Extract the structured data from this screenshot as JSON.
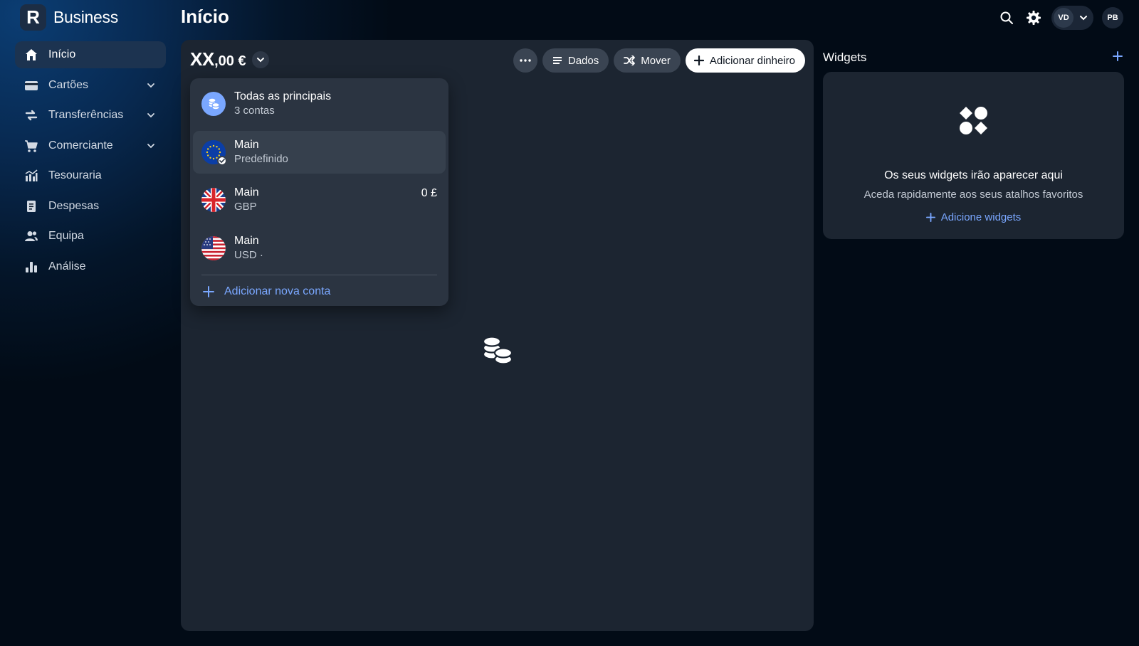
{
  "app": {
    "brand_name": "Business",
    "logo_letter": "R"
  },
  "header": {
    "title": "Início",
    "user_initials": "VD",
    "profile_initials": "PB"
  },
  "sidebar": {
    "items": [
      {
        "label": "Início",
        "icon": "home-icon",
        "active": true,
        "expandable": false
      },
      {
        "label": "Cartões",
        "icon": "card-icon",
        "expandable": true
      },
      {
        "label": "Transferências",
        "icon": "transfer-icon",
        "expandable": true
      },
      {
        "label": "Comerciante",
        "icon": "cart-icon",
        "expandable": true
      },
      {
        "label": "Tesouraria",
        "icon": "treasury-chart-icon",
        "expandable": false
      },
      {
        "label": "Despesas",
        "icon": "receipt-icon",
        "expandable": false
      },
      {
        "label": "Equipa",
        "icon": "team-icon",
        "expandable": false
      },
      {
        "label": "Análise",
        "icon": "bar-chart-icon",
        "expandable": false
      }
    ]
  },
  "balance": {
    "integer": "XX",
    "decimal": ",00 €"
  },
  "actions": {
    "more_icon": "more-dots-icon",
    "data_label": "Dados",
    "move_label": "Mover",
    "add_money_label": "Adicionar dinheiro"
  },
  "account_dropdown": {
    "all": {
      "name": "Todas as principais",
      "sub": "3 contas"
    },
    "accounts": [
      {
        "name": "Main",
        "sub": "Predefinido",
        "flag": "eu-flag-icon",
        "selected": true,
        "amount": ""
      },
      {
        "name": "Main",
        "sub": "GBP",
        "flag": "uk-flag-icon",
        "selected": false,
        "amount": "0 £"
      },
      {
        "name": "Main",
        "sub": "USD ·",
        "flag": "us-flag-icon",
        "selected": false,
        "amount": ""
      }
    ],
    "add_label": "Adicionar nova conta"
  },
  "widgets": {
    "title": "Widgets",
    "empty_heading": "Os seus widgets irão aparecer aqui",
    "empty_sub": "Aceda rapidamente aos seus atalhos favoritos",
    "add_link": "Adicione widgets"
  },
  "colors": {
    "accent_link": "#7aa7ff",
    "panel_bg": "#1c2531",
    "dropdown_bg": "#2b3441"
  }
}
